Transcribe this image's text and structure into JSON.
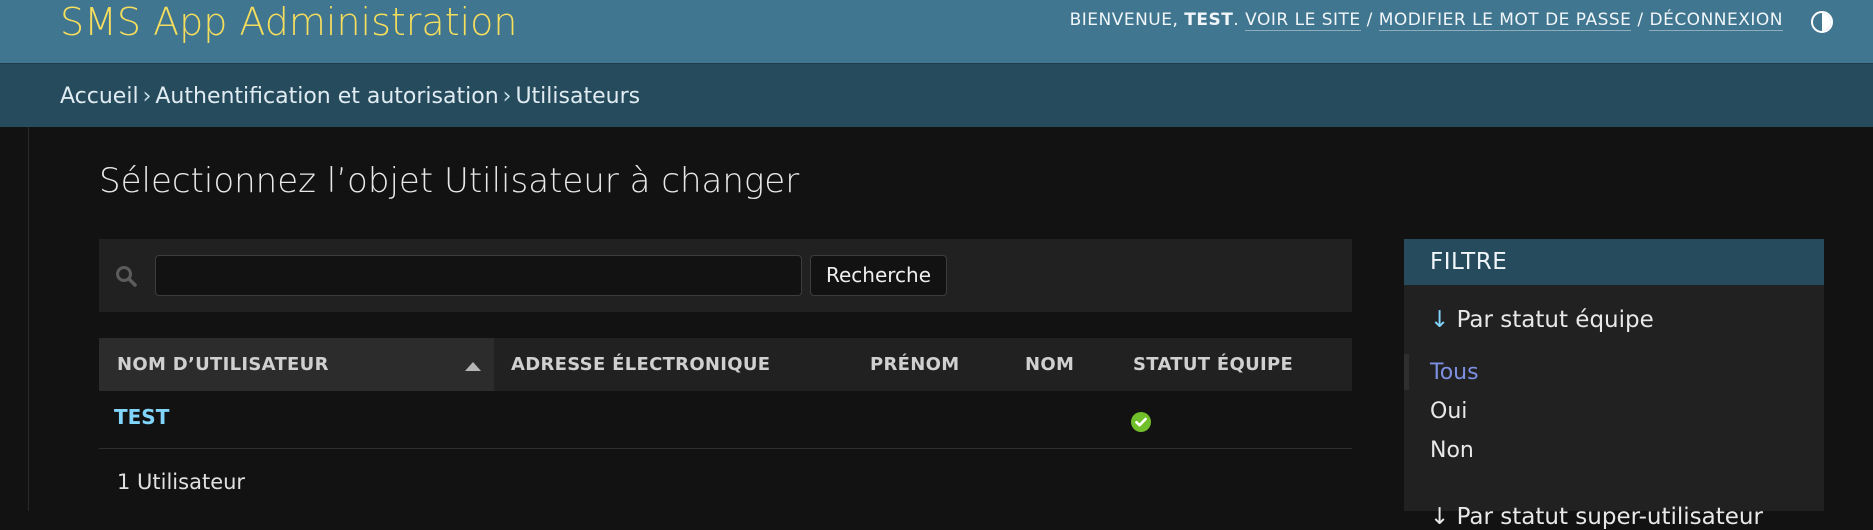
{
  "header": {
    "title": "SMS App Administration",
    "welcome": "BIENVENUE,",
    "username": "TEST",
    "links": [
      "VOIR LE SITE",
      "MODIFIER LE MOT DE PASSE",
      "DÉCONNEXION"
    ],
    "separator": "/",
    "theme_icon": "half-circle-icon",
    "colors": {
      "bar": "#417690",
      "branding": "#f5dd5d"
    }
  },
  "breadcrumbs": {
    "items": [
      "Accueil",
      "Authentification et autorisation",
      "Utilisateurs"
    ],
    "separator": "›"
  },
  "main": {
    "title": "Sélectionnez l’objet Utilisateur à changer",
    "search": {
      "value": "",
      "placeholder": "",
      "button_label": "Recherche",
      "icon": "search-icon"
    },
    "table": {
      "columns": [
        "NOM D’UTILISATEUR",
        "ADRESSE ÉLECTRONIQUE",
        "PRÉNOM",
        "NOM",
        "STATUT ÉQUIPE"
      ],
      "sorted_column": "NOM D’UTILISATEUR",
      "rows": [
        {
          "username": "TEST",
          "email": "",
          "first_name": "",
          "last_name": "",
          "staff": "check-circle-icon"
        }
      ]
    },
    "count": "1 Utilisateur"
  },
  "filter": {
    "title": "FILTRE",
    "groups": [
      {
        "arrow": "↓",
        "label": "Par statut équipe",
        "options": [
          "Tous",
          "Oui",
          "Non"
        ],
        "selected": "Tous"
      }
    ],
    "next_group_partial": "↓ Par statut super-utilisateur"
  }
}
